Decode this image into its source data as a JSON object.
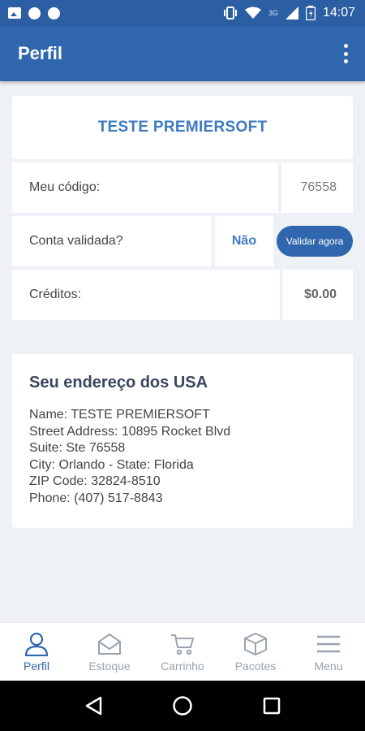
{
  "status_bar": {
    "network": "3G",
    "time": "14:07"
  },
  "app_bar": {
    "title": "Perfil"
  },
  "profile": {
    "name": "TESTE PREMIERSOFT",
    "code_label": "Meu código:",
    "code_value": "76558",
    "validated_label": "Conta validada?",
    "validated_value": "Não",
    "validate_button": "Validar agora",
    "credits_label": "Créditos:",
    "credits_value": "$0.00"
  },
  "address": {
    "title": "Seu endereço dos USA",
    "lines": [
      "Name: TESTE PREMIERSOFT",
      "Street Address: 10895 Rocket Blvd",
      "Suite: Ste 76558",
      "City: Orlando - State: Florida",
      "ZIP Code: 32824-8510",
      "Phone: (407) 517-8843"
    ]
  },
  "bottom_nav": {
    "items": [
      {
        "label": "Perfil",
        "icon": "user-icon"
      },
      {
        "label": "Estoque",
        "icon": "inbox-icon"
      },
      {
        "label": "Carrinho",
        "icon": "cart-icon"
      },
      {
        "label": "Pacotes",
        "icon": "package-icon"
      },
      {
        "label": "Menu",
        "icon": "menu-icon"
      }
    ]
  },
  "colors": {
    "primary": "#2f66ad",
    "accent_text": "#3d7ac2",
    "inactive": "#9aa3ae",
    "background": "#eef1f5"
  }
}
